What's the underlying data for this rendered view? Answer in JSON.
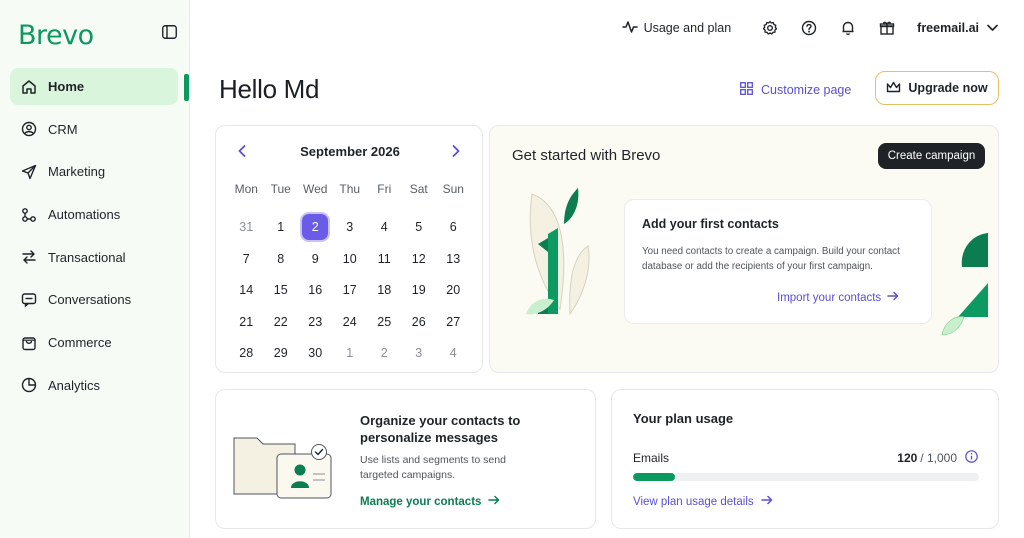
{
  "app": {
    "logo": "Brevo"
  },
  "sidebar": {
    "items": [
      {
        "label": "Home",
        "icon": "home-icon",
        "active": true
      },
      {
        "label": "CRM",
        "icon": "user-circle-icon"
      },
      {
        "label": "Marketing",
        "icon": "paper-plane-icon"
      },
      {
        "label": "Automations",
        "icon": "workflow-icon"
      },
      {
        "label": "Transactional",
        "icon": "swap-arrows-icon"
      },
      {
        "label": "Conversations",
        "icon": "chat-icon"
      },
      {
        "label": "Commerce",
        "icon": "shopping-bag-icon"
      },
      {
        "label": "Analytics",
        "icon": "pie-chart-icon"
      }
    ]
  },
  "topbar": {
    "usage_label": "Usage and plan",
    "account_label": "freemail.ai",
    "icons": [
      "activity-icon",
      "gear-icon",
      "help-icon",
      "bell-icon",
      "gift-icon",
      "chevron-down-icon"
    ]
  },
  "header": {
    "title": "Hello Md",
    "customize_label": "Customize page",
    "upgrade_label": "Upgrade now"
  },
  "calendar": {
    "month_label": "September 2026",
    "weekdays": [
      "Mon",
      "Tue",
      "Wed",
      "Thu",
      "Fri",
      "Sat",
      "Sun"
    ],
    "weeks": [
      [
        "31",
        "1",
        "2",
        "3",
        "4",
        "5",
        "6"
      ],
      [
        "7",
        "8",
        "9",
        "10",
        "11",
        "12",
        "13"
      ],
      [
        "14",
        "15",
        "16",
        "17",
        "18",
        "19",
        "20"
      ],
      [
        "21",
        "22",
        "23",
        "24",
        "25",
        "26",
        "27"
      ],
      [
        "28",
        "29",
        "30",
        "1",
        "2",
        "3",
        "4"
      ]
    ],
    "selected": "2"
  },
  "get_started": {
    "title": "Get started with Brevo",
    "create_label": "Create campaign",
    "card_title": "Add your first contacts",
    "card_desc": "You need contacts to create a campaign. Build your contact database or add the recipients of your first campaign.",
    "card_link": "Import your contacts"
  },
  "organize": {
    "title": "Organize your contacts to personalize messages",
    "desc": "Use lists and segments to send targeted campaigns.",
    "link": "Manage your contacts"
  },
  "plan": {
    "title": "Your plan usage",
    "emails_label": "Emails",
    "used": "120",
    "total": "/ 1,000",
    "fraction": 0.12,
    "link": "View plan usage details"
  },
  "colors": {
    "brand": "#0b9960",
    "accent": "#5b4fd6",
    "upgrade_border": "#e8c063"
  }
}
